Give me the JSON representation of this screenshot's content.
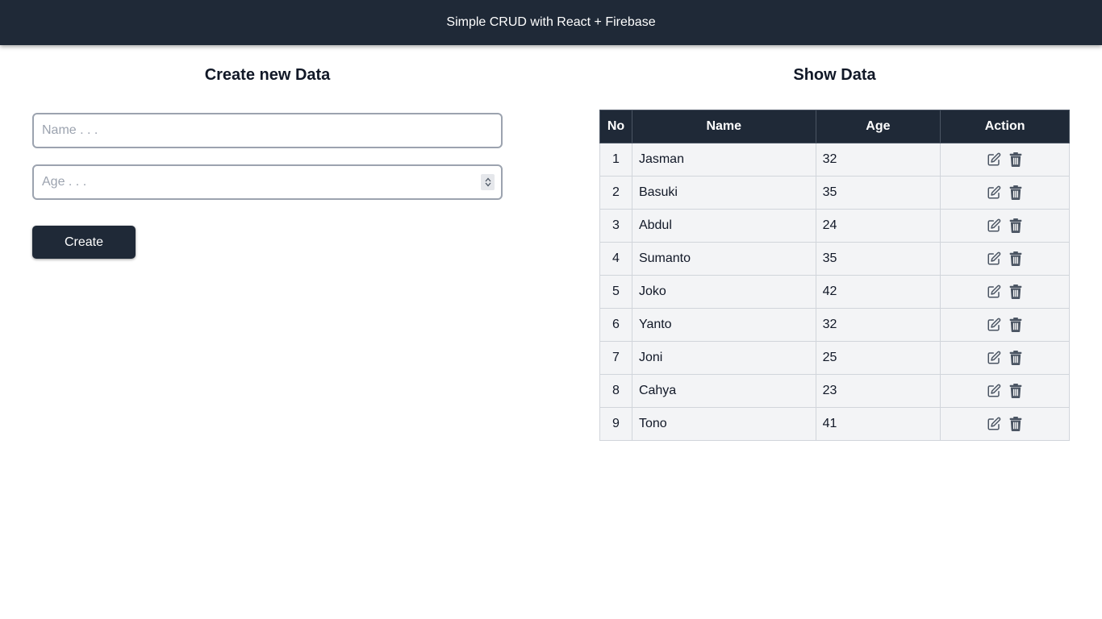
{
  "navbar": {
    "title": "Simple CRUD with React + Firebase"
  },
  "create": {
    "title": "Create new Data",
    "name_placeholder": "Name . . .",
    "age_placeholder": "Age . . .",
    "button_label": "Create"
  },
  "show": {
    "title": "Show Data",
    "columns": [
      "No",
      "Name",
      "Age",
      "Action"
    ],
    "rows": [
      {
        "no": "1",
        "name": "Jasman",
        "age": "32"
      },
      {
        "no": "2",
        "name": "Basuki",
        "age": "35"
      },
      {
        "no": "3",
        "name": "Abdul",
        "age": "24"
      },
      {
        "no": "4",
        "name": "Sumanto",
        "age": "35"
      },
      {
        "no": "5",
        "name": "Joko",
        "age": "42"
      },
      {
        "no": "6",
        "name": "Yanto",
        "age": "32"
      },
      {
        "no": "7",
        "name": "Joni",
        "age": "25"
      },
      {
        "no": "8",
        "name": "Cahya",
        "age": "23"
      },
      {
        "no": "9",
        "name": "Tono",
        "age": "41"
      }
    ],
    "row_actions": [
      "edit-icon",
      "trash-icon"
    ]
  },
  "colors": {
    "navbar_bg": "#1f2937",
    "button_bg": "#1f2937",
    "row_bg": "#f3f4f6",
    "icon": "#4b5563"
  }
}
